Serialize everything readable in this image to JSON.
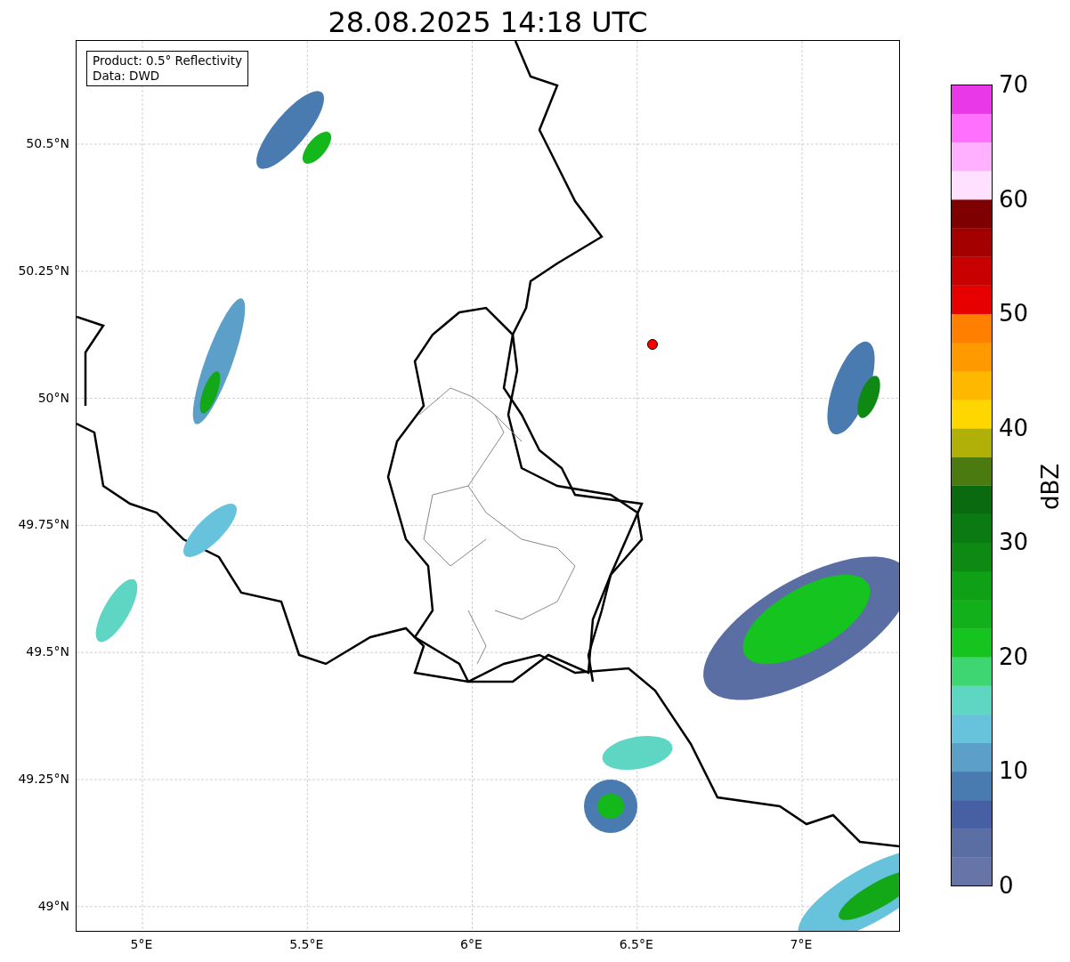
{
  "title": "28.08.2025 14:18 UTC",
  "legend": [
    "Product: 0.5° Reflectivity",
    "Data: DWD"
  ],
  "map": {
    "y_ticks": [
      "50.5°N",
      "50.25°N",
      "50°N",
      "49.75°N",
      "49.5°N",
      "49.25°N",
      "49°N"
    ],
    "x_ticks": [
      "5°E",
      "5.5°E",
      "6°E",
      "6.5°E",
      "7°E"
    ]
  },
  "colorbar": {
    "label": "dBZ",
    "ticks": [
      "70",
      "60",
      "50",
      "40",
      "30",
      "20",
      "10",
      "0"
    ]
  }
}
